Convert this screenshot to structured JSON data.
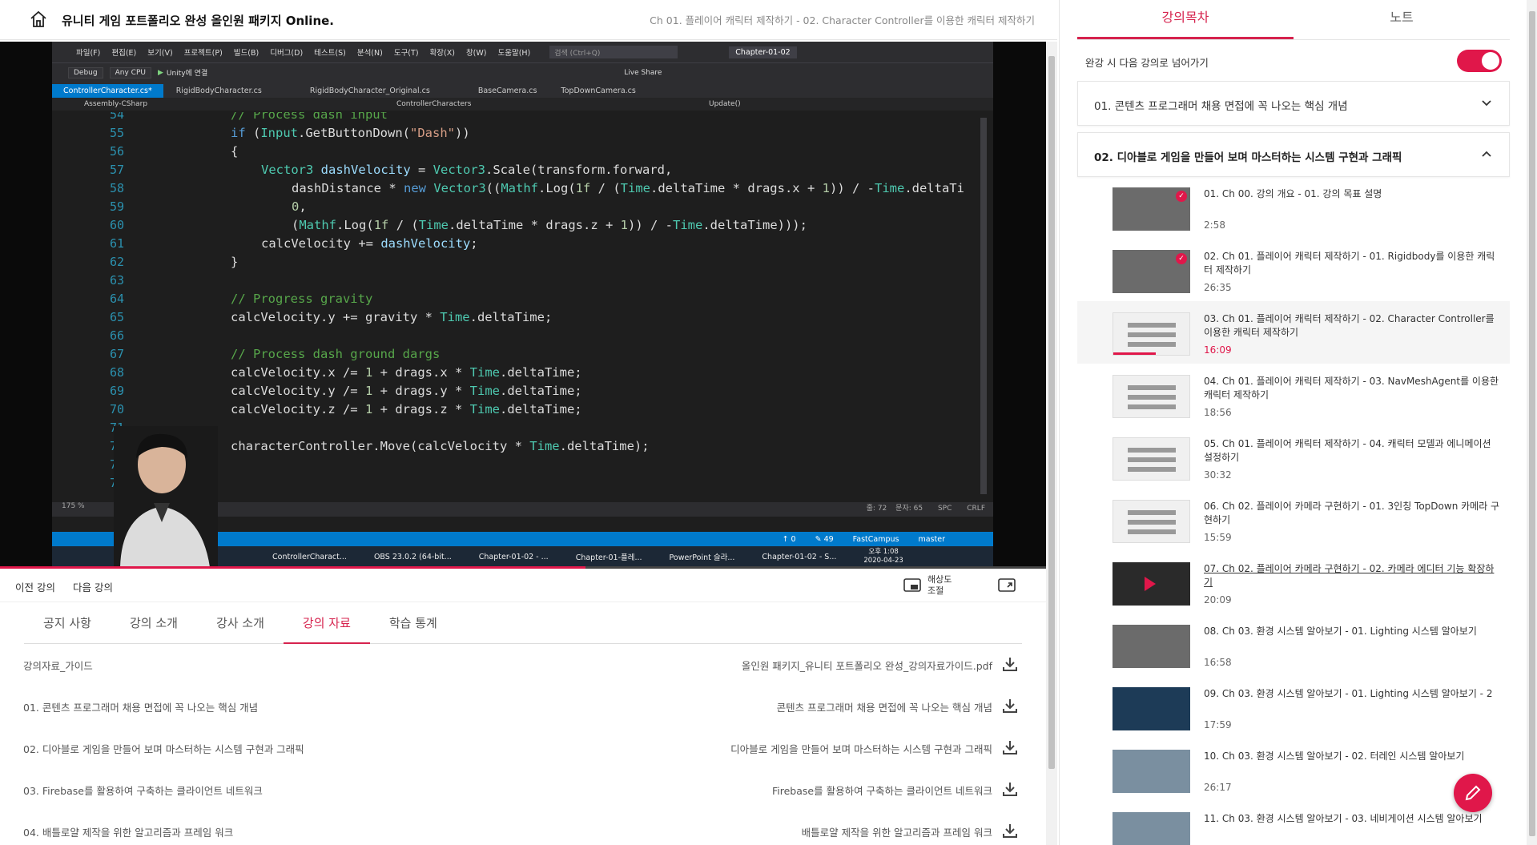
{
  "header": {
    "course_title": "유니티 게임 포트폴리오 완성 올인원 패키지 Online.",
    "lesson_title": "Ch 01. 플레이어 캐릭터 제작하기 - 02. Character Controller를 이용한 캐릭터 제작하기"
  },
  "video": {
    "progress": 0.56,
    "ide": {
      "menu": [
        "파일(F)",
        "편집(E)",
        "보기(V)",
        "프로젝트(P)",
        "빌드(B)",
        "디버그(D)",
        "테스트(S)",
        "분석(N)",
        "도구(T)",
        "확장(X)",
        "창(W)",
        "도움말(H)"
      ],
      "search_placeholder": "검색 (Ctrl+Q)",
      "solution_name": "Chapter-01-02",
      "config": "Debug",
      "platform": "Any CPU",
      "run_label": "Unity에 연결",
      "live_share": "Live Share",
      "tabs": [
        "ControllerCharacter.cs*",
        "RigidBodyCharacter.cs",
        "RigidBodyCharacter_Original.cs",
        "BaseCamera.cs",
        "TopDownCamera.cs"
      ],
      "nav": [
        "Assembly-CSharp",
        "ControllerCharacters",
        "Update()"
      ],
      "zoom": "175 %",
      "cursor_line": "줄: 72",
      "cursor_col": "문자: 65",
      "insert_mode": "SPC",
      "line_ending": "CRLF",
      "status": [
        "↑ 0",
        "✎ 49",
        "FastCampus",
        "master"
      ],
      "taskbar": [
        "ControllerCharact...",
        "OBS 23.0.2 (64-bit...",
        "Chapter-01-02 - ...",
        "Chapter-01-플레...",
        "PowerPoint 슬라...",
        "Chapter-01-02 - S..."
      ],
      "clock_time": "오후 1:08",
      "clock_date": "2020-04-23",
      "code_lines": [
        {
          "n": "54",
          "t": "// Process dash input",
          "k": "cmt",
          "i": 0
        },
        {
          "n": "55",
          "t": "if (Input.GetButtonDown(\"Dash\"))",
          "k": "code",
          "i": 0
        },
        {
          "n": "56",
          "t": "{",
          "k": "code",
          "i": 0
        },
        {
          "n": "57",
          "t": "Vector3 dashVelocity = Vector3.Scale(transform.forward,",
          "k": "code",
          "i": 1
        },
        {
          "n": "58",
          "t": "dashDistance * new Vector3((Mathf.Log(1f / (Time.deltaTime * drags.x + 1)) / -Time.deltaTi",
          "k": "code",
          "i": 2
        },
        {
          "n": "59",
          "t": "0,",
          "k": "code",
          "i": 2
        },
        {
          "n": "60",
          "t": "(Mathf.Log(1f / (Time.deltaTime * drags.z + 1)) / -Time.deltaTime)));",
          "k": "code",
          "i": 2
        },
        {
          "n": "61",
          "t": "calcVelocity += dashVelocity;",
          "k": "code",
          "i": 1
        },
        {
          "n": "62",
          "t": "}",
          "k": "code",
          "i": 0
        },
        {
          "n": "63",
          "t": "",
          "k": "code",
          "i": 0
        },
        {
          "n": "64",
          "t": "// Progress gravity",
          "k": "cmt",
          "i": 0
        },
        {
          "n": "65",
          "t": "calcVelocity.y += gravity * Time.deltaTime;",
          "k": "code",
          "i": 0
        },
        {
          "n": "66",
          "t": "",
          "k": "code",
          "i": 0
        },
        {
          "n": "67",
          "t": "// Process dash ground dargs",
          "k": "cmt",
          "i": 0
        },
        {
          "n": "68",
          "t": "calcVelocity.x /= 1 + drags.x * Time.deltaTime;",
          "k": "code",
          "i": 0
        },
        {
          "n": "69",
          "t": "calcVelocity.y /= 1 + drags.y * Time.deltaTime;",
          "k": "code",
          "i": 0
        },
        {
          "n": "70",
          "t": "calcVelocity.z /= 1 + drags.z * Time.deltaTime;",
          "k": "code",
          "i": 0
        },
        {
          "n": "71",
          "t": "",
          "k": "code",
          "i": 0
        },
        {
          "n": "72",
          "t": "characterController.Move(calcVelocity * Time.deltaTime);",
          "k": "code",
          "i": 0
        },
        {
          "n": "73",
          "t": "}",
          "k": "code",
          "i": -1
        },
        {
          "n": "74",
          "t": "",
          "k": "code",
          "i": -1
        }
      ]
    }
  },
  "controls": {
    "prev": "이전 강의",
    "next": "다음 강의",
    "resolution_line1": "해상도",
    "resolution_line2": "조절"
  },
  "content_tabs": [
    "공지 사항",
    "강의 소개",
    "강사 소개",
    "강의 자료",
    "학습 통계"
  ],
  "content_tab_active": 3,
  "materials": [
    {
      "name": "강의자료_가이드",
      "file": "올인원 패키지_유니티 포트폴리오 완성_강의자료가이드.pdf"
    },
    {
      "name": "01. 콘텐츠 프로그래머 채용 면접에 꼭 나오는 핵심 개념",
      "file": "콘텐츠 프로그래머 채용 면접에 꼭 나오는 핵심 개념"
    },
    {
      "name": "02. 디아블로 게임을 만들어 보며 마스터하는 시스템 구현과 그래픽",
      "file": "디아블로 게임을 만들어 보며 마스터하는 시스템 구현과 그래픽"
    },
    {
      "name": "03. Firebase를 활용하여 구축하는 클라이언트 네트워크",
      "file": "Firebase를 활용하여 구축하는 클라이언트 네트워크"
    },
    {
      "name": "04. 배틀로얄 제작을 위한 알고리즘과 프레임 워크",
      "file": "배틀로얄 제작을 위한 알고리즘과 프레임 워크"
    }
  ],
  "sidebar": {
    "tabs": [
      "강의목차",
      "노트"
    ],
    "autoplay_label": "완강 시 다음 강의로 넘어가기",
    "autoplay_on": true,
    "sections": [
      {
        "title": "01. 콘텐츠 프로그래머 채용 면접에 꼭 나오는 핵심 개념",
        "expanded": false
      },
      {
        "title": "02. 디아블로 게임을 만들어 보며 마스터하는 시스템 구현과 그래픽",
        "expanded": true
      }
    ],
    "lessons": [
      {
        "title": "01. Ch 00. 강의 개요 - 01. 강의 목표 설명",
        "duration": "2:58",
        "status": "done",
        "thumb": "gray"
      },
      {
        "title": "02. Ch 01. 플레이어 캐릭터 제작하기 - 01. Rigidbody를 이용한 캐릭터 제작하기",
        "duration": "26:35",
        "status": "done",
        "thumb": "gray"
      },
      {
        "title": "03. Ch 01. 플레이어 캐릭터 제작하기 - 02. Character Controller를 이용한 캐릭터 제작하기",
        "duration": "16:09",
        "status": "current",
        "thumb": "light",
        "progress": 0.56
      },
      {
        "title": "04. Ch 01. 플레이어 캐릭터 제작하기 - 03. NavMeshAgent를 이용한 캐릭터 제작하기",
        "duration": "18:56",
        "status": "",
        "thumb": "light"
      },
      {
        "title": "05. Ch 01. 플레이어 캐릭터 제작하기 - 04. 캐릭터 모델과 에니메이션 설정하기",
        "duration": "30:32",
        "status": "",
        "thumb": "light"
      },
      {
        "title": "06. Ch 02. 플레이어 카메라 구현하기 - 01. 3인칭 TopDown 카메라 구현하기",
        "duration": "15:59",
        "status": "",
        "thumb": "light"
      },
      {
        "title": "07. Ch 02. 플레이어 카메라 구현하기 - 02. 카메라 에디터 기능 확장하기",
        "duration": "20:09",
        "status": "hover",
        "thumb": "dark"
      },
      {
        "title": "08. Ch 03. 환경 시스템 알아보기 - 01. Lighting 시스템 알아보기",
        "duration": "16:58",
        "status": "",
        "thumb": "gray"
      },
      {
        "title": "09. Ch 03. 환경 시스템 알아보기 - 01. Lighting 시스템 알아보기 - 2",
        "duration": "17:59",
        "status": "",
        "thumb": "blue"
      },
      {
        "title": "10. Ch 03. 환경 시스템 알아보기 - 02. 터레인 시스템 알아보기",
        "duration": "26:17",
        "status": "",
        "thumb": "scene"
      },
      {
        "title": "11. Ch 03. 환경 시스템 알아보기 - 03. 네비게이션 시스템 알아보기",
        "duration": "",
        "status": "",
        "thumb": "scene"
      }
    ]
  },
  "colors": {
    "accent": "#e0174a",
    "vs_blue": "#007acc"
  }
}
